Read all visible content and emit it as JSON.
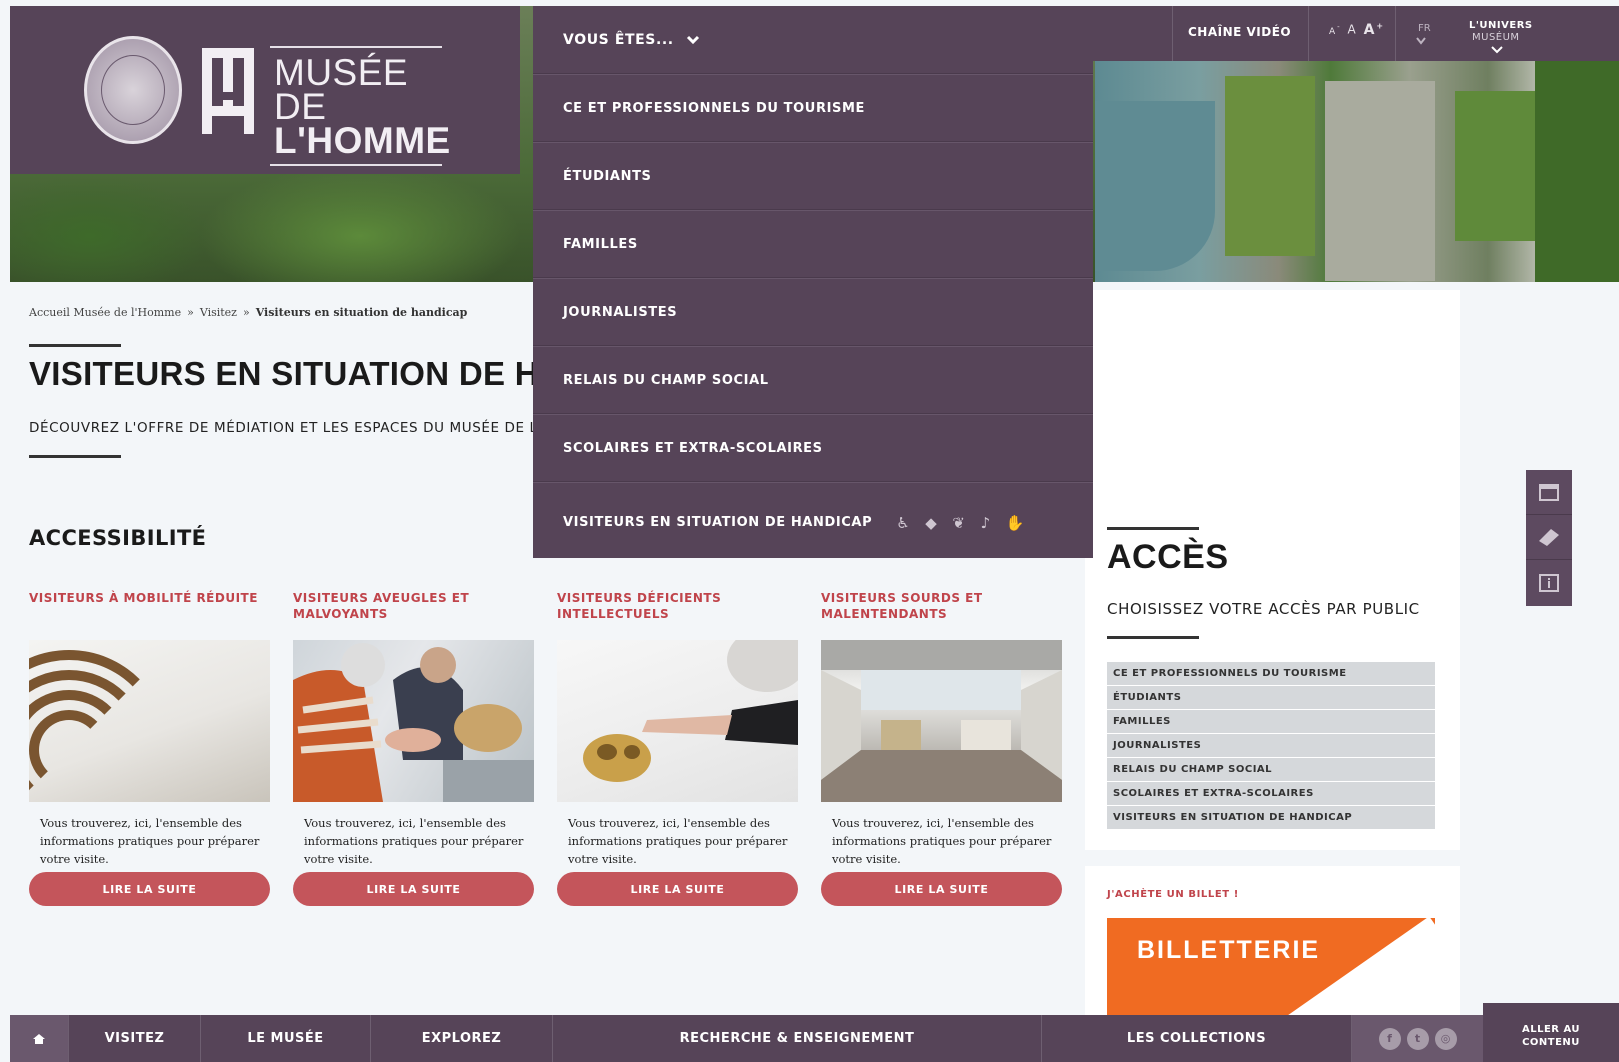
{
  "logo": {
    "line1": "MUSÉE DE",
    "line2": "L'HOMME",
    "mark_letters": "MH"
  },
  "top_bar": {
    "video_label": "CHAÎNE VIDÉO",
    "font_small": "A",
    "font_mid": "A",
    "font_large": "A",
    "font_small_sign": "-",
    "font_large_sign": "+",
    "lang": "FR",
    "univers_line1": "L'UNIVERS",
    "univers_line2": "MUSÉUM"
  },
  "dropdown": {
    "header": "VOUS ÊTES...",
    "items": [
      "CE ET PROFESSIONNELS DU TOURISME",
      "ÉTUDIANTS",
      "FAMILLES",
      "JOURNALISTES",
      "RELAIS DU CHAMP SOCIAL",
      "SCOLAIRES ET EXTRA-SCOLAIRES",
      "VISITEURS EN SITUATION DE HANDICAP"
    ],
    "handicap_icons": [
      "wheelchair-icon",
      "eye-icon",
      "brain-icon",
      "ear-icon",
      "sign-language-icon"
    ]
  },
  "breadcrumb": {
    "home": "Accueil Musée de l'Homme",
    "sep": "»",
    "visit": "Visitez",
    "current": "Visiteurs en situation de handicap"
  },
  "page": {
    "title": "VISITEURS EN SITUATION DE HANDICAP",
    "subtitle": "DÉCOUVREZ L'OFFRE DE MÉDIATION ET LES ESPACES DU MUSÉE DE L'HOMME",
    "section_title": "ACCESSIBILITÉ"
  },
  "cards": [
    {
      "title": "VISITEURS À MOBILITÉ RÉDUITE",
      "text": "Vous trouverez, ici, l'ensemble des informations pratiques pour préparer votre visite.",
      "button": "LIRE LA SUITE"
    },
    {
      "title": "VISITEURS AVEUGLES ET MALVOYANTS",
      "text": "Vous trouverez, ici, l'ensemble des informations pratiques pour préparer votre visite.",
      "button": "LIRE LA SUITE"
    },
    {
      "title": "VISITEURS DÉFICIENTS INTELLECTUELS",
      "text": "Vous trouverez, ici, l'ensemble des informations pratiques pour préparer votre visite.",
      "button": "LIRE LA SUITE"
    },
    {
      "title": "VISITEURS SOURDS ET MALENTENDANTS",
      "text": "Vous trouverez, ici, l'ensemble des informations pratiques pour préparer votre visite.",
      "button": "LIRE LA SUITE"
    }
  ],
  "acces": {
    "title": "ACCÈS",
    "subtitle": "CHOISISSEZ VOTRE ACCÈS PAR PUBLIC",
    "items": [
      "CE ET PROFESSIONNELS DU TOURISME",
      "ÉTUDIANTS",
      "FAMILLES",
      "JOURNALISTES",
      "RELAIS DU CHAMP SOCIAL",
      "SCOLAIRES ET EXTRA-SCOLAIRES",
      "VISITEURS EN SITUATION DE HANDICAP"
    ]
  },
  "billet": {
    "label": "J'ACHÈTE UN BILLET !",
    "box_text": "BILLETTERIE"
  },
  "bottom_nav": {
    "items": [
      "VISITEZ",
      "LE MUSÉE",
      "EXPLOREZ",
      "RECHERCHE & ENSEIGNEMENT",
      "LES COLLECTIONS"
    ],
    "social": [
      "facebook-icon",
      "twitter-icon",
      "instagram-icon"
    ],
    "skip_line1": "ALLER AU",
    "skip_line2": "CONTENU"
  },
  "colors": {
    "brand_purple": "#564458",
    "accent_red": "#c0444b",
    "button_red": "#c4555b",
    "ticket_orange": "#f06b22"
  }
}
